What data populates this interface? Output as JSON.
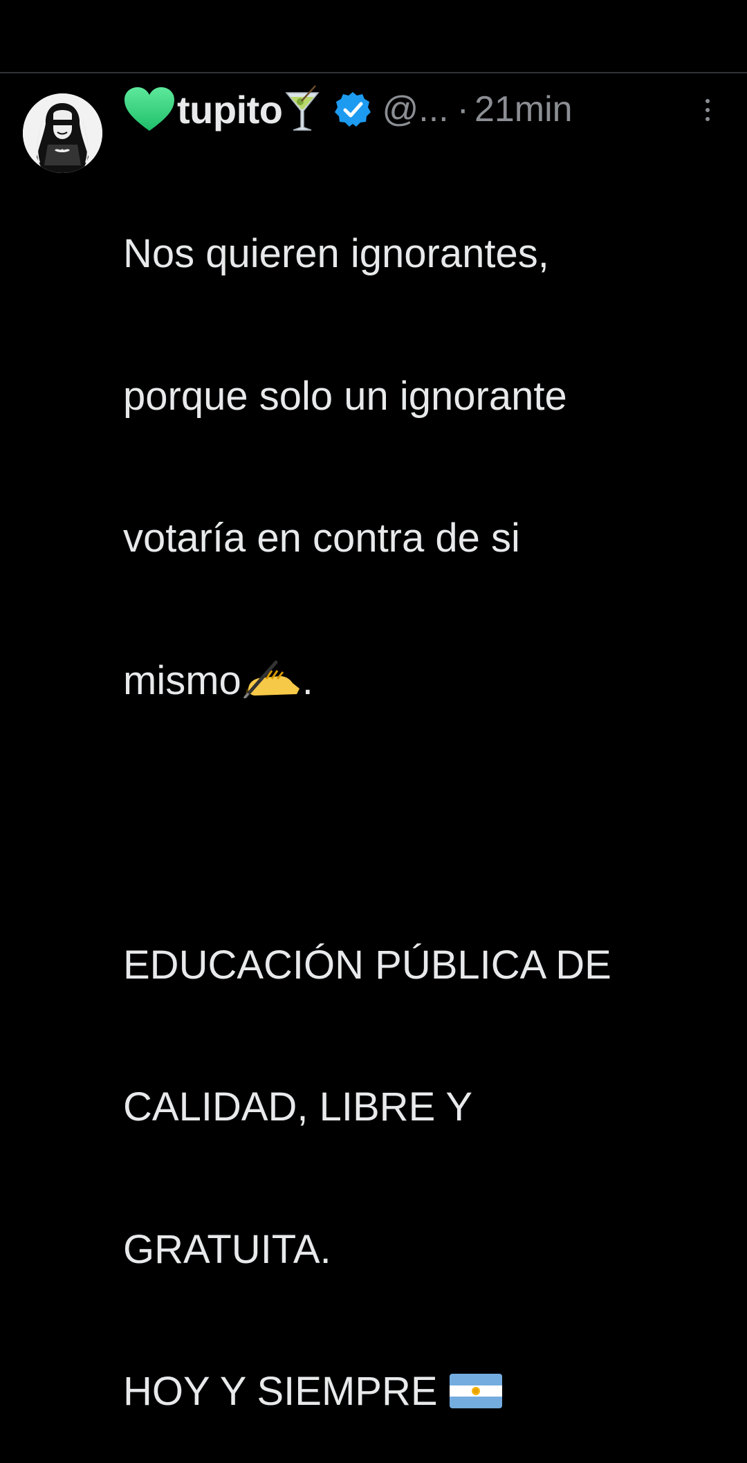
{
  "tweet": {
    "author": {
      "display_name": "tupito",
      "name_prefix_icon": "green-heart-icon",
      "name_suffix_icon": "cocktail-glass-icon",
      "verified_icon": "verified-badge-icon",
      "handle": "@...",
      "separator": "·",
      "time": "21min",
      "avatar_icon": "profile-avatar"
    },
    "more_icon": "vertical-ellipsis-icon",
    "body": {
      "line1": "Nos quieren ignorantes,",
      "line2": "porque solo un ignorante",
      "line3": "votaría en contra de si",
      "line4_text": "mismo",
      "line4_icon": "writing-hand-icon",
      "line4_end": ".",
      "line5": "EDUCACIÓN PÚBLICA DE",
      "line6": "CALIDAD, LIBRE Y",
      "line7": "GRATUITA.",
      "line8_text": "HOY Y SIEMPRE ",
      "line8_icon": "argentina-flag-icon"
    },
    "colors": {
      "background": "#000000",
      "text": "#e7e9ea",
      "muted": "#8b8f94",
      "verified_blue": "#1d9bf0",
      "heart_green": "#3ddc84"
    }
  }
}
